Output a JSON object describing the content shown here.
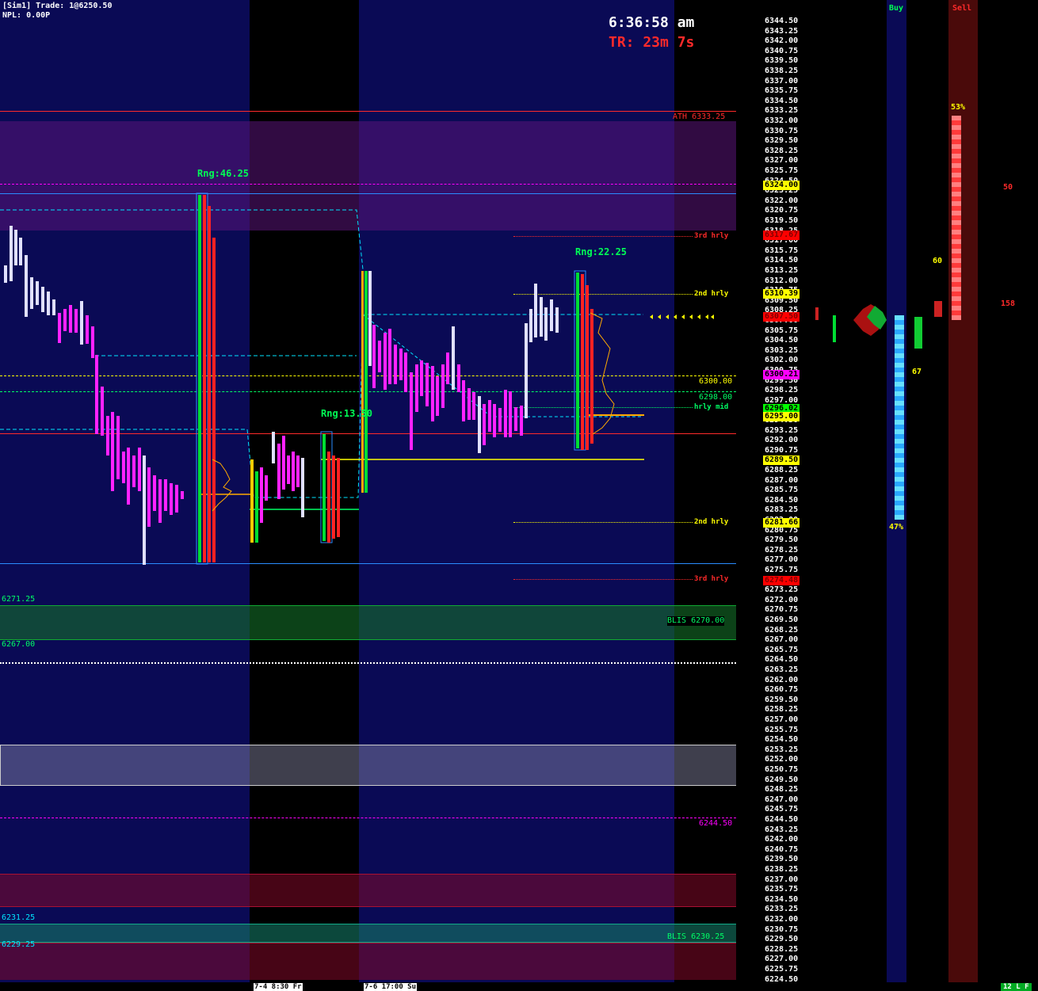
{
  "header": {
    "account_line": "[Sim1]  Trade: 1@6250.50",
    "npl_line": "NPL: 0.00P",
    "clock": "6:36:58 am",
    "timer": "TR: 23m 7s"
  },
  "range_labels": {
    "left": "Rng:46.25",
    "middle": "Rng:13.50",
    "right": "Rng:22.25"
  },
  "level_labels": {
    "ath": "ATH  6333.25",
    "third_hrly_top": "3rd hrly",
    "second_hrly_top": "2nd hrly",
    "level_6300": "6300.00",
    "level_6298": "6298.00",
    "hrly_mid": "hrly mid",
    "second_hrly_bottom": "2nd hrly",
    "third_hrly_bottom": "3rd hrly",
    "blis_upper": "BLIS  6270.00",
    "level_6271": "6271.25",
    "level_6267": "6267.00",
    "level_6244": "6244.50",
    "level_6231": "6231.25",
    "level_6229": "6229.25",
    "blis_lower": "BLIS  6230.25"
  },
  "price_axis": {
    "ticks": [
      "6344.50",
      "6343.25",
      "6342.00",
      "6340.75",
      "6339.50",
      "6338.25",
      "6337.00",
      "6335.75",
      "6334.50",
      "6333.25",
      "6332.00",
      "6330.75",
      "6329.50",
      "6328.25",
      "6327.00",
      "6325.75",
      "6324.50",
      "6323.25",
      "6322.00",
      "6320.75",
      "6319.50",
      "6318.25",
      "6317.00",
      "6315.75",
      "6314.50",
      "6313.25",
      "6312.00",
      "6310.75",
      "6309.50",
      "6308.25",
      "6307.00",
      "6305.75",
      "6304.50",
      "6303.25",
      "6302.00",
      "6300.75",
      "6299.50",
      "6298.25",
      "6297.00",
      "6295.75",
      "6294.50",
      "6293.25",
      "6292.00",
      "6290.75",
      "6289.50",
      "6288.25",
      "6287.00",
      "6285.75",
      "6284.50",
      "6283.25",
      "6282.00",
      "6280.75",
      "6279.50",
      "6278.25",
      "6277.00",
      "6275.75",
      "6274.50",
      "6273.25",
      "6272.00",
      "6270.75",
      "6269.50",
      "6268.25",
      "6267.00",
      "6265.75",
      "6264.50",
      "6263.25",
      "6262.00",
      "6260.75",
      "6259.50",
      "6258.25",
      "6257.00",
      "6255.75",
      "6254.50",
      "6253.25",
      "6252.00",
      "6250.75",
      "6249.50",
      "6248.25",
      "6247.00",
      "6245.75",
      "6244.50",
      "6243.25",
      "6242.00",
      "6240.75",
      "6239.50",
      "6238.25",
      "6237.00",
      "6235.75",
      "6234.50",
      "6233.25",
      "6232.00",
      "6230.75",
      "6229.50",
      "6228.25",
      "6227.00",
      "6225.75",
      "6224.50"
    ],
    "badges": [
      {
        "text": "6324.00",
        "bg": "#ffff00",
        "fg": "#000000",
        "price": 6324.0
      },
      {
        "text": "6317.67",
        "bg": "#ff0000",
        "fg": "#800000",
        "price": 6317.67
      },
      {
        "text": "6310.39",
        "bg": "#ffff00",
        "fg": "#000000",
        "price": 6310.39
      },
      {
        "text": "6307.50",
        "bg": "#ff0000",
        "fg": "#800000",
        "price": 6307.5
      },
      {
        "text": "6300.21",
        "bg": "#ff00ff",
        "fg": "#000000",
        "price": 6300.21
      },
      {
        "text": "6296.02",
        "bg": "#00ff00",
        "fg": "#000000",
        "price": 6296.02
      },
      {
        "text": "6295.00",
        "bg": "#ffff00",
        "fg": "#000000",
        "price": 6295.0
      },
      {
        "text": "6289.50",
        "bg": "#ffff00",
        "fg": "#000000",
        "price": 6289.5
      },
      {
        "text": "6281.66",
        "bg": "#ffff00",
        "fg": "#000000",
        "price": 6281.66
      },
      {
        "text": "6274.48",
        "bg": "#ff0000",
        "fg": "#800000",
        "price": 6274.48
      }
    ]
  },
  "side_panel": {
    "buy_label": "Buy",
    "sell_label": "Sell",
    "buy_pct": "47%",
    "sell_pct": "53%",
    "delta_top": "60",
    "delta_bottom": "67",
    "sell_count_1": "50",
    "sell_count_2": "158"
  },
  "time_axis": {
    "label_1": "7-4  8:30 Fr",
    "label_2": "7-6  17:00 Su",
    "status_badge": "12 L F"
  },
  "colors": {
    "session_blue": "#0a0a55",
    "session_black": "#000000",
    "purple_zone": "#2e0a5e",
    "green_zone": "#0d4a1e",
    "red_zone": "#4a0a22",
    "accent_green": "#00ff00",
    "accent_red": "#ff0000",
    "accent_yellow": "#ffff00",
    "accent_cyan": "#00e5ff",
    "accent_magenta": "#ff00ff"
  }
}
